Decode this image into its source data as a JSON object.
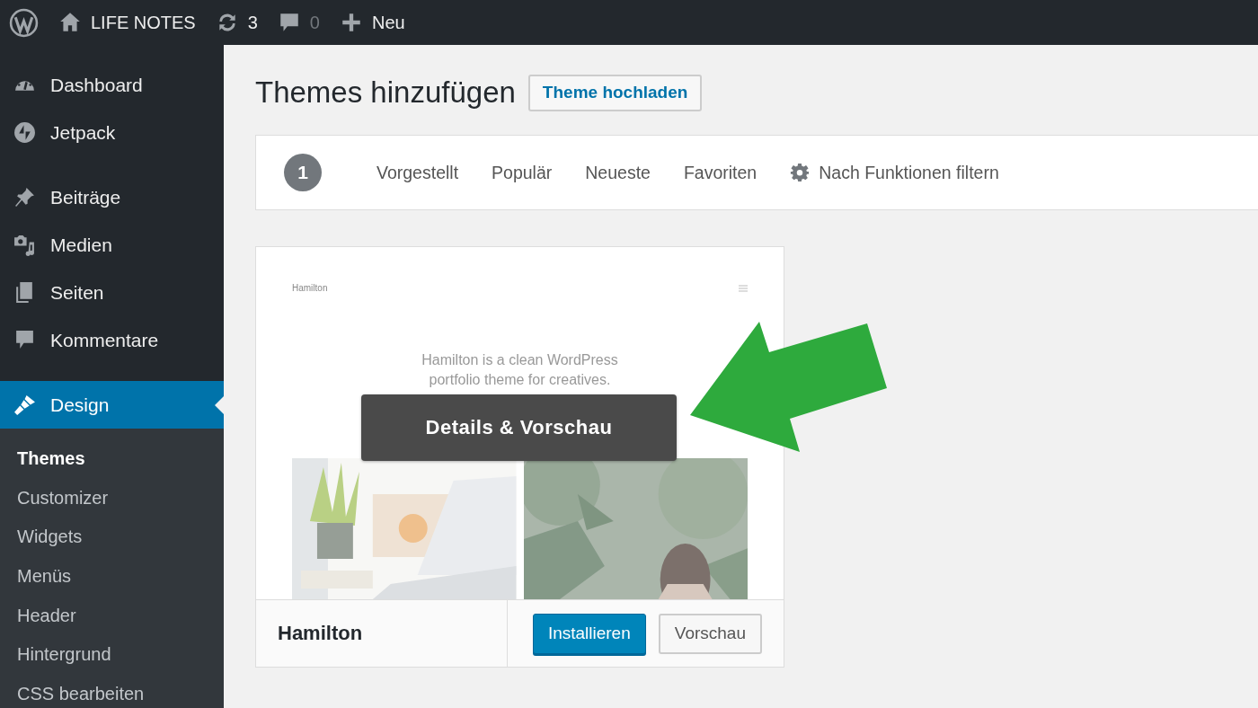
{
  "admin_bar": {
    "site_name": "LIFE NOTES",
    "updates": "3",
    "comments": "0",
    "new_label": "Neu"
  },
  "sidebar": {
    "groups": [
      [
        {
          "label": "Dashboard",
          "selected": false
        },
        {
          "label": "Jetpack",
          "selected": false
        }
      ],
      [
        {
          "label": "Beiträge",
          "selected": false
        },
        {
          "label": "Medien",
          "selected": false
        },
        {
          "label": "Seiten",
          "selected": false
        },
        {
          "label": "Kommentare",
          "selected": false
        }
      ],
      [
        {
          "label": "Design",
          "selected": true
        }
      ]
    ],
    "submenu": [
      {
        "label": "Themes",
        "selected": true
      },
      {
        "label": "Customizer",
        "selected": false
      },
      {
        "label": "Widgets",
        "selected": false
      },
      {
        "label": "Menüs",
        "selected": false
      },
      {
        "label": "Header",
        "selected": false
      },
      {
        "label": "Hintergrund",
        "selected": false
      },
      {
        "label": "CSS bearbeiten",
        "selected": false
      }
    ]
  },
  "page": {
    "title": "Themes hinzufügen",
    "upload_button": "Theme hochladen"
  },
  "filter_bar": {
    "count": "1",
    "tabs": [
      {
        "label": "Vorgestellt",
        "selected": false
      },
      {
        "label": "Populär",
        "selected": false
      },
      {
        "label": "Neueste",
        "selected": false
      },
      {
        "label": "Favoriten",
        "selected": false
      }
    ],
    "feature_filter": "Nach Funktionen filtern"
  },
  "themes": [
    {
      "name": "Hamilton",
      "preview": {
        "site_title": "Hamilton",
        "tagline": "Hamilton is a clean WordPress portfolio theme for creatives."
      },
      "hover_label": "Details & Vorschau",
      "install_button": "Installieren",
      "preview_button": "Vorschau"
    }
  ]
}
